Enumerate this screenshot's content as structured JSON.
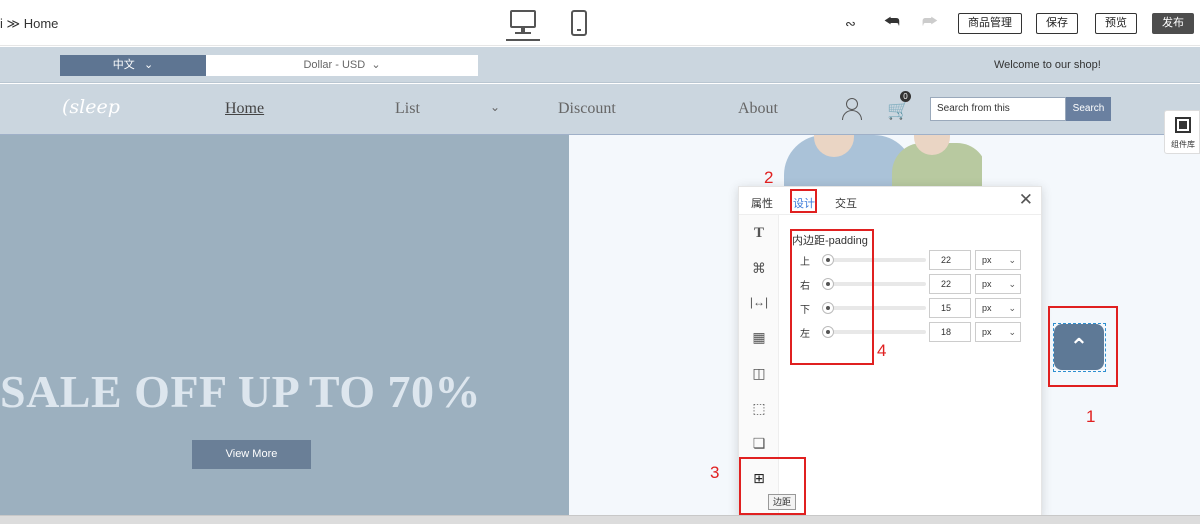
{
  "editor": {
    "breadcrumb": "i ≫ Home",
    "undo_icon": "undo-icon",
    "redo_icon": "redo-icon",
    "eye_icon": "hide-eye-icon",
    "buttons": {
      "products": "商品管理",
      "save": "保存",
      "preview": "预览",
      "publish": "发布"
    }
  },
  "site": {
    "lang": "中文",
    "currency": "Dollar - USD",
    "welcome": "Welcome to our shop!",
    "logo": "sleep",
    "nav": [
      "Home",
      "List",
      "Discount",
      "About"
    ],
    "cart_count": "0",
    "search_placeholder": "Search from this",
    "search_button": "Search"
  },
  "hero": {
    "title": "SALE OFF UP TO 70%",
    "button": "View More",
    "left_color": "#9cb0bf"
  },
  "component_library": {
    "label": "组件库"
  },
  "panel": {
    "tabs": [
      "属性",
      "设计",
      "交互"
    ],
    "section_title": "内边距-padding",
    "rows": [
      {
        "label": "上",
        "value": "22",
        "unit": "px"
      },
      {
        "label": "右",
        "value": "22",
        "unit": "px"
      },
      {
        "label": "下",
        "value": "15",
        "unit": "px"
      },
      {
        "label": "左",
        "value": "18",
        "unit": "px"
      }
    ],
    "tooltip": "边距",
    "accent": "#3d7bd9"
  },
  "annotations": [
    "1",
    "2",
    "3",
    "4"
  ],
  "annotation_color": "#e02020"
}
